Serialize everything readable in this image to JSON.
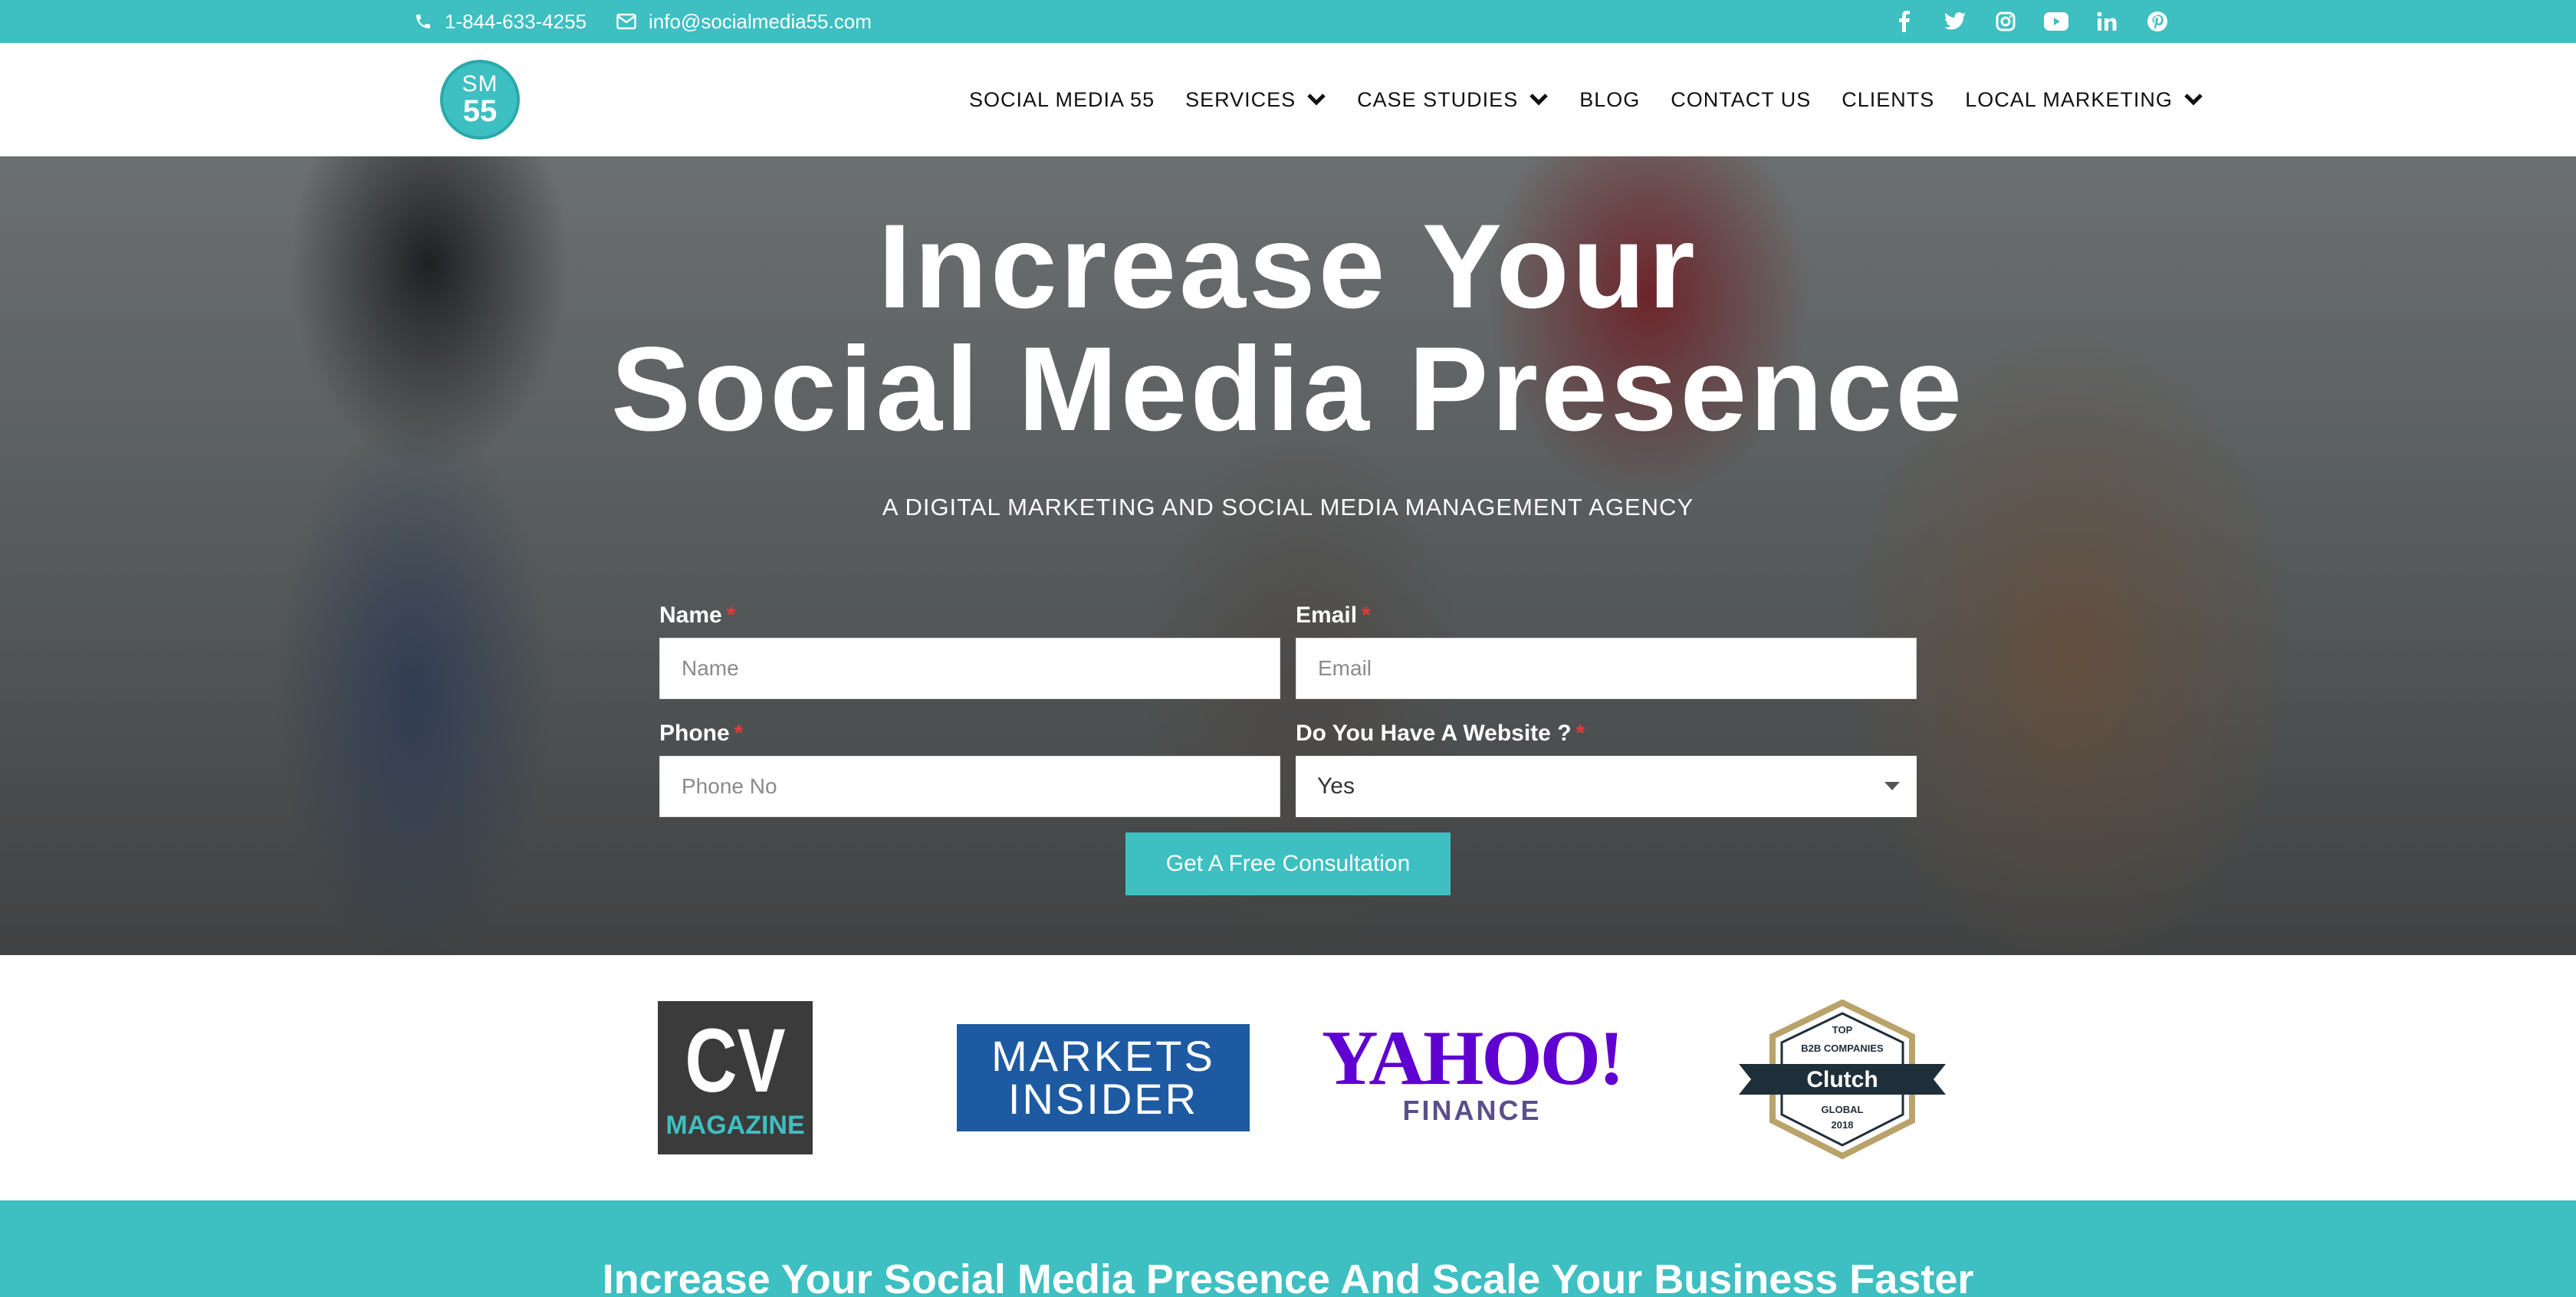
{
  "topbar": {
    "phone": "1-844-633-4255",
    "email": "info@socialmedia55.com",
    "social_icons": [
      "facebook-icon",
      "twitter-icon",
      "instagram-icon",
      "youtube-icon",
      "linkedin-icon",
      "pinterest-icon"
    ]
  },
  "header": {
    "logo": {
      "line1": "SM",
      "line2": "55"
    },
    "nav": [
      {
        "label": "SOCIAL MEDIA 55",
        "dropdown": false
      },
      {
        "label": "SERVICES",
        "dropdown": true
      },
      {
        "label": "CASE STUDIES",
        "dropdown": true
      },
      {
        "label": "BLOG",
        "dropdown": false
      },
      {
        "label": "CONTACT US",
        "dropdown": false
      },
      {
        "label": "CLIENTS",
        "dropdown": false
      },
      {
        "label": "LOCAL MARKETING",
        "dropdown": true
      }
    ]
  },
  "hero": {
    "title_line1": "Increase Your",
    "title_line2": "Social Media Presence",
    "subtitle": "A DIGITAL MARKETING AND SOCIAL MEDIA MANAGEMENT AGENCY",
    "form": {
      "name_label": "Name",
      "name_placeholder": "Name",
      "email_label": "Email",
      "email_placeholder": "Email",
      "phone_label": "Phone",
      "phone_placeholder": "Phone No",
      "website_label": "Do You Have A Website ?",
      "website_value": "Yes",
      "required_mark": "*",
      "submit_label": "Get A Free Consultation"
    }
  },
  "press": {
    "cv": {
      "top": "CV",
      "bottom": "MAGAZINE"
    },
    "markets_insider": {
      "line1": "MARKETS",
      "line2": "INSIDER"
    },
    "yahoo": {
      "top": "YAHOO!",
      "bottom": "FINANCE"
    },
    "clutch": {
      "top": "TOP",
      "mid": "B2B COMPANIES",
      "name": "Clutch",
      "low": "GLOBAL",
      "year": "2018"
    }
  },
  "band": {
    "title": "Increase Your Social Media Presence And Scale Your Business Faster"
  },
  "colors": {
    "accent": "#3ebfc1",
    "required": "#e23b3b",
    "yahoo_purple": "#5f01d1",
    "markets_blue": "#1e5aa1"
  }
}
